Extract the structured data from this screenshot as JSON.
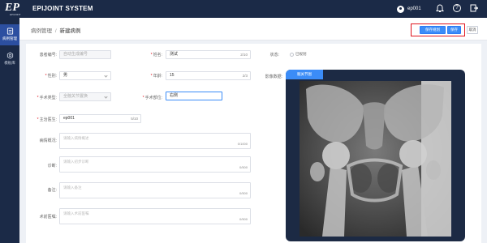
{
  "topbar": {
    "logo_mark": "EP",
    "logo_sub": "EPIJOINT",
    "title": "EPIJOINT SYSTEM",
    "username": "ep001",
    "help_icon": "?",
    "icons": [
      "user-avatar-icon",
      "bell-icon",
      "help-circle-icon",
      "logout-icon"
    ]
  },
  "sidebar": {
    "items": [
      {
        "label": "病例管理",
        "icon": "folder-icon",
        "active": true
      },
      {
        "label": "模板库",
        "icon": "gear-icon",
        "active": false
      }
    ]
  },
  "header": {
    "breadcrumb_parent": "病例管理",
    "breadcrumb_sep": "/",
    "breadcrumb_current": "新建病例",
    "buttons": {
      "save_and_plan": "保存规划",
      "save": "保存",
      "cancel": "取消"
    }
  },
  "form": {
    "case_id": {
      "label": "患者编号:",
      "value": "自动生成编号"
    },
    "name": {
      "label": "姓名:",
      "value": "测试",
      "count": "2/10"
    },
    "status": {
      "label": "状态:",
      "value": "已规划"
    },
    "gender": {
      "label": "性别:",
      "value": "男"
    },
    "age": {
      "label": "年龄:",
      "value": "15",
      "count": "2/3"
    },
    "image_label": "影像数据:",
    "surgery_type": {
      "label": "手术类型:",
      "value": "全髋关节置换"
    },
    "surgery_side": {
      "label": "手术部位:",
      "value": "右侧"
    },
    "doctor": {
      "label": "主治医生:",
      "value": "ep001",
      "count": "5/10"
    },
    "history": {
      "label": "病情概况:",
      "placeholder": "请输入病情概述",
      "count": "0/1000"
    },
    "diagnosis": {
      "label": "诊断:",
      "placeholder": "请输入初步诊断",
      "count": "0/500"
    },
    "remark": {
      "label": "备注:",
      "placeholder": "请输入备注",
      "count": "0/500"
    },
    "notes": {
      "label": "术前医嘱:",
      "placeholder": "请输入术前医嘱",
      "count": "0/500"
    }
  },
  "image_panel": {
    "tab": "髋关节图"
  },
  "colors": {
    "nav_bg": "#1b2a47",
    "accent": "#3b8cf7",
    "highlight": "#e0141e"
  }
}
